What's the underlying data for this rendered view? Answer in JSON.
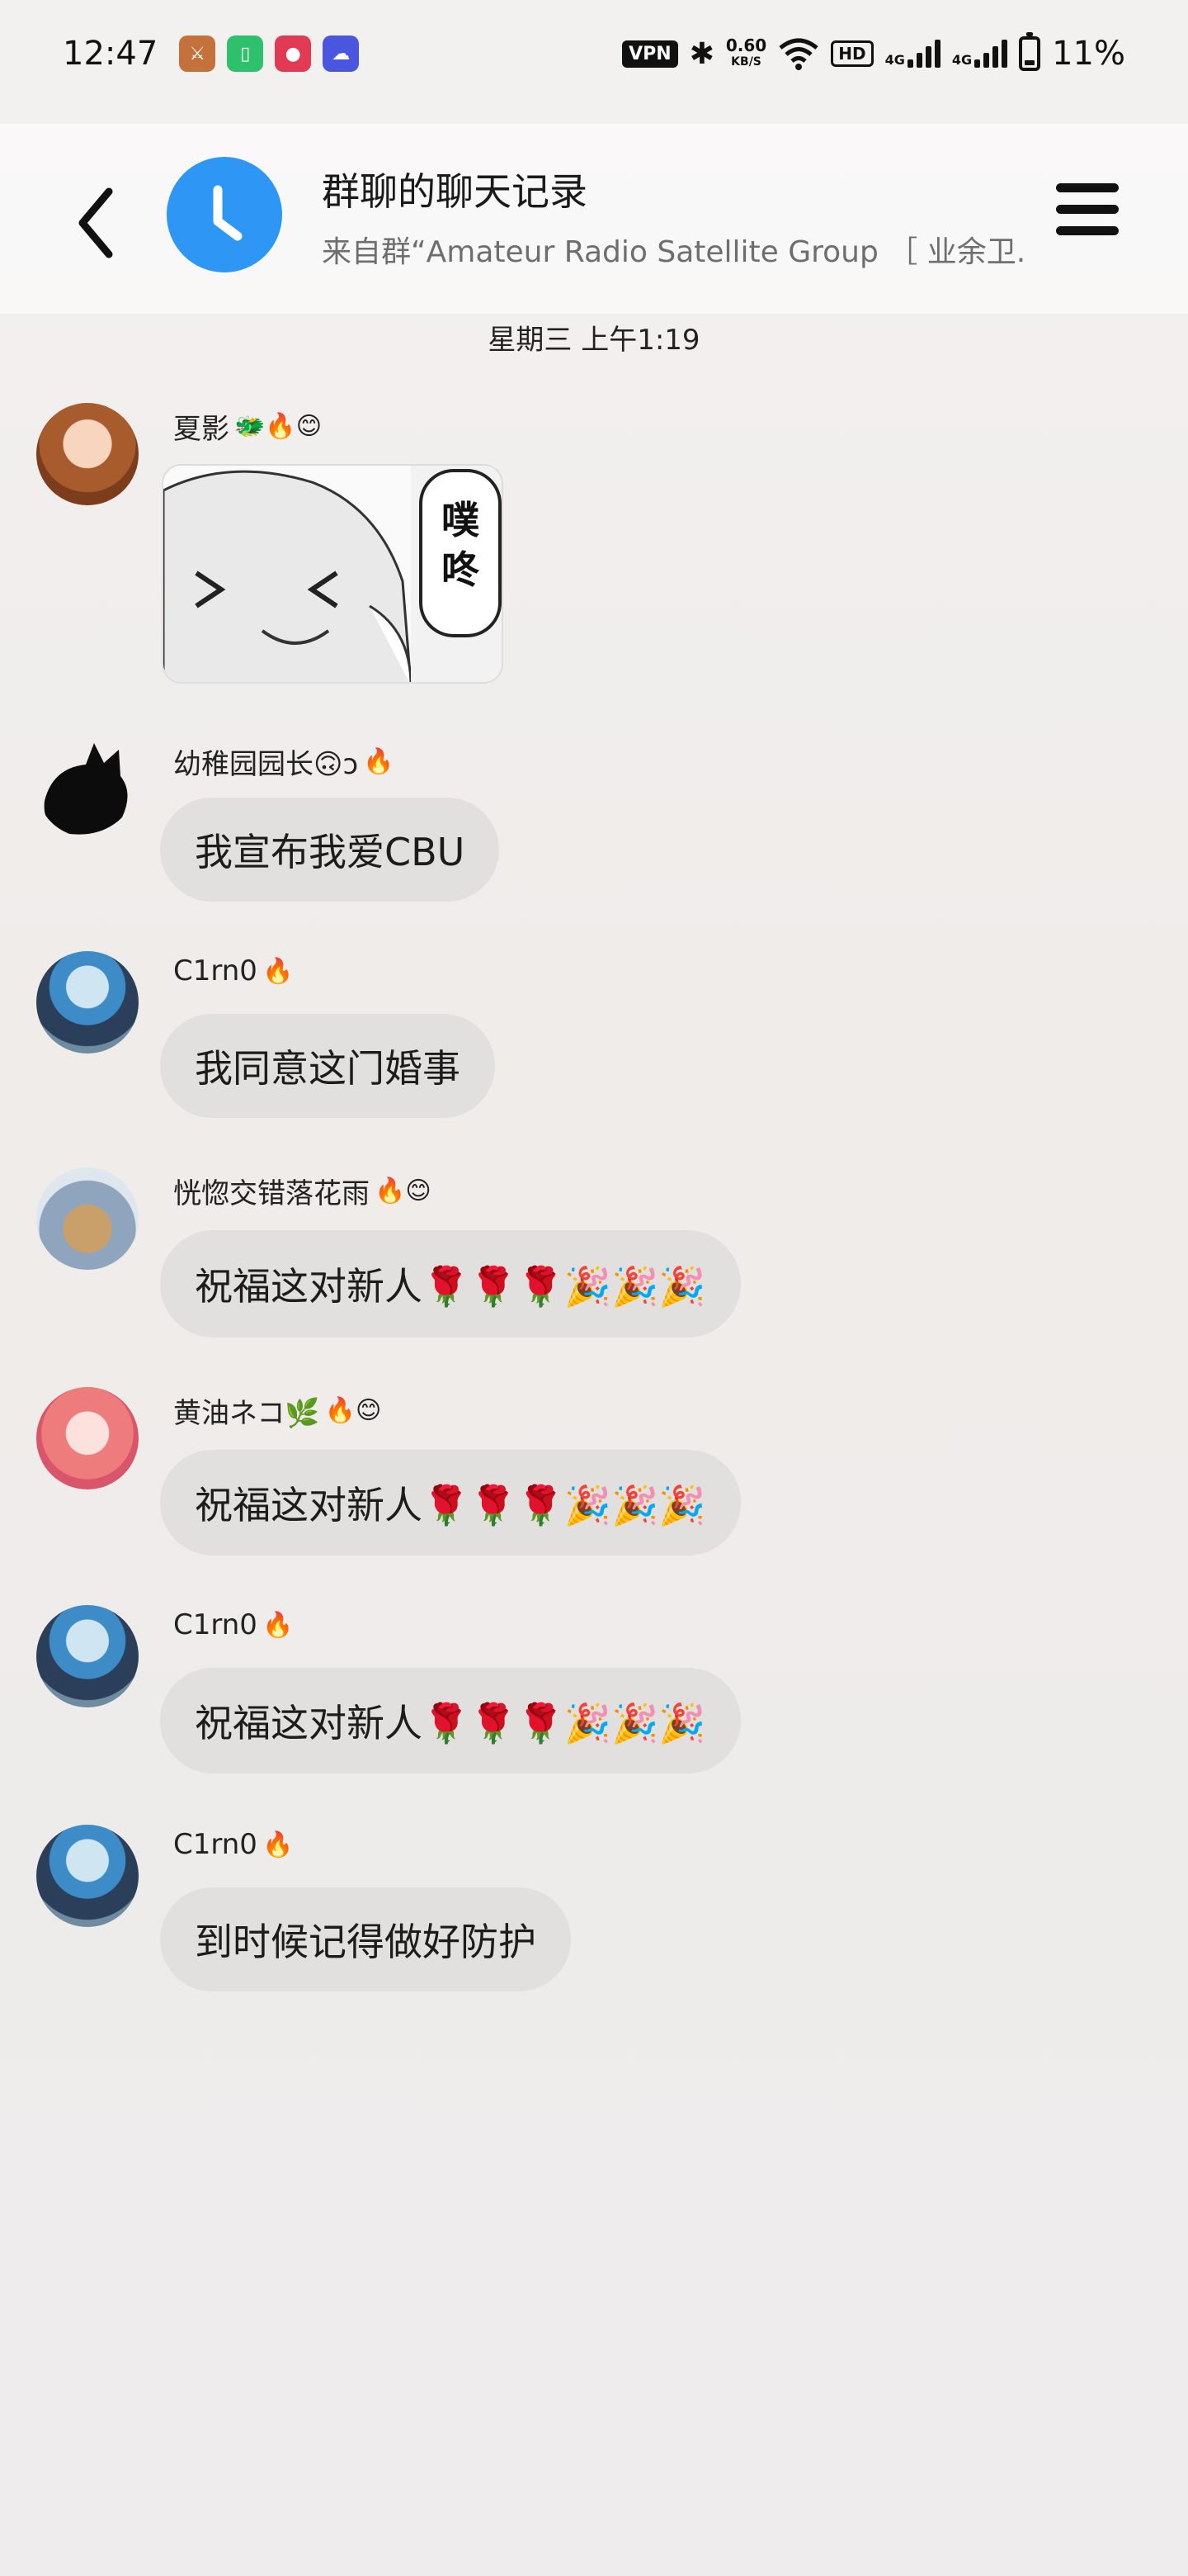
{
  "status_bar": {
    "time": "12:47",
    "vpn": "VPN",
    "speed_value": "0.60",
    "speed_unit": "KB/S",
    "hd": "HD",
    "net1": "4G",
    "net2": "4G",
    "battery": "11%"
  },
  "header": {
    "title": "群聊的聊天记录",
    "subtitle": "来自群“Amateur Radio Satellite Group ［ 业余卫..."
  },
  "date_separator": "星期三 上午1:19",
  "messages": [
    {
      "nickname": "夏影",
      "badges": "🐲🔥😊",
      "type": "sticker",
      "sticker_text": "噗咚"
    },
    {
      "nickname": "幼稚园园长🙃ↄ",
      "badges": "🔥",
      "type": "text",
      "text": "我宣布我爱CBU"
    },
    {
      "nickname": "C1rn0",
      "badges": "🔥",
      "type": "text",
      "text": "我同意这门婚事"
    },
    {
      "nickname": "恍惚交错落花雨",
      "badges": "🔥😊",
      "type": "text",
      "text": "祝福这对新人🌹🌹🌹🎉🎉🎉"
    },
    {
      "nickname": "黄油ネコ🌿",
      "badges": "🔥😊",
      "type": "text",
      "text": "祝福这对新人🌹🌹🌹🎉🎉🎉"
    },
    {
      "nickname": "C1rn0",
      "badges": "🔥",
      "type": "text",
      "text": "祝福这对新人🌹🌹🌹🎉🎉🎉"
    },
    {
      "nickname": "C1rn0",
      "badges": "🔥",
      "type": "text",
      "text": "到时候记得做好防护"
    }
  ],
  "colors": {
    "header_avatar": "#2e96f5",
    "bubble": "#e2dfdf"
  }
}
